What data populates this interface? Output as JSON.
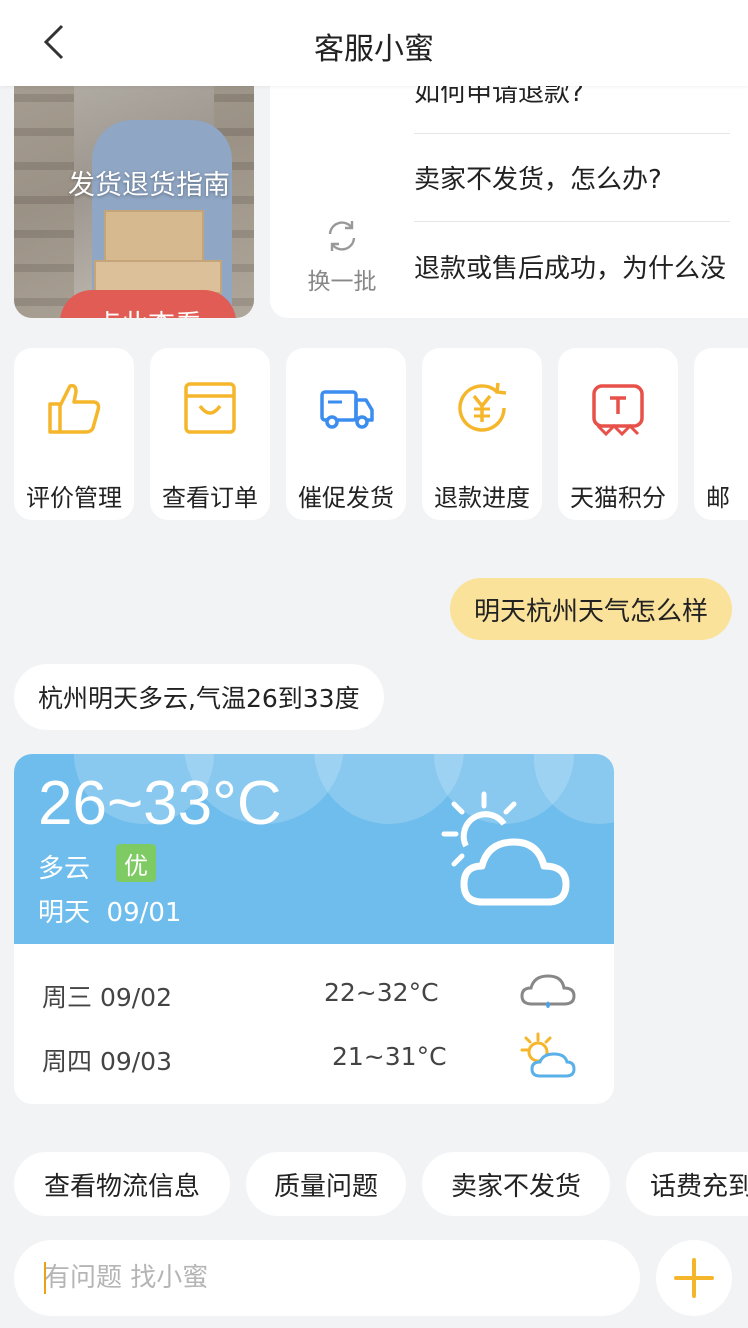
{
  "header": {
    "title": "客服小蜜",
    "back_icon": "chevron-left-icon"
  },
  "guide_card": {
    "title": "发货退货指南",
    "button_label": "点此查看"
  },
  "faq": {
    "refresh_label": "换一批",
    "items": [
      "如何申请退款?",
      "卖家不发货，怎么办?",
      "退款或售后成功，为什么没"
    ]
  },
  "actions": [
    {
      "label": "评价管理",
      "icon": "thumbs-up-icon",
      "color": "#f5b62b"
    },
    {
      "label": "查看订单",
      "icon": "order-bag-icon",
      "color": "#f5b62b"
    },
    {
      "label": "催促发货",
      "icon": "delivery-truck-icon",
      "color": "#3b8df0"
    },
    {
      "label": "退款进度",
      "icon": "refund-yuan-icon",
      "color": "#f5b62b"
    },
    {
      "label": "天猫积分",
      "icon": "tmall-icon",
      "color": "#e8504a"
    },
    {
      "label": "邮",
      "icon": "mail-icon",
      "color": "#3b8df0"
    }
  ],
  "chat": {
    "user_message": "明天杭州天气怎么样",
    "bot_message": "杭州明天多云,气温26到33度"
  },
  "weather": {
    "temp_range": "26~33°C",
    "condition": "多云",
    "aqi": "优",
    "day": "明天",
    "date": "09/01",
    "forecast": [
      {
        "day": "周三 09/02",
        "temp": "22~32°C",
        "icon": "rain-cloud-icon"
      },
      {
        "day": "周四 09/03",
        "temp": "21~31°C",
        "icon": "partly-sunny-icon"
      }
    ]
  },
  "chips": [
    "查看物流信息",
    "质量问题",
    "卖家不发货",
    "话费充到"
  ],
  "input": {
    "placeholder": "有问题 找小蜜"
  },
  "colors": {
    "accent": "#f5b62b",
    "user_bubble": "#fbe29a",
    "weather_blue": "#6fbdec",
    "button_red": "#e05c55"
  }
}
